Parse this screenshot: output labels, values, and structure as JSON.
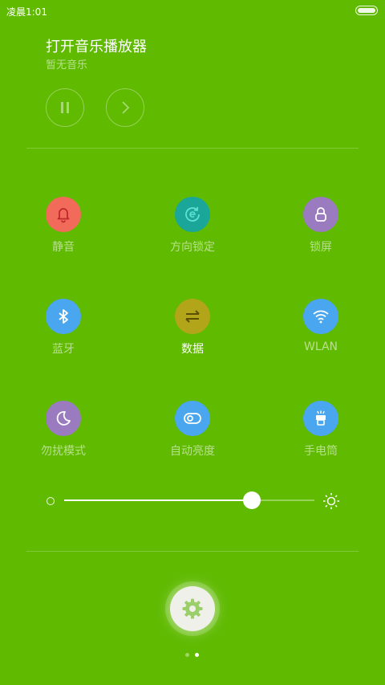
{
  "status_bar": {
    "time": "凌晨1:01"
  },
  "music": {
    "title": "打开音乐播放器",
    "subtitle": "暂无音乐"
  },
  "toggles": [
    {
      "label": "静音",
      "icon": "bell-icon",
      "color": "#f26b5a",
      "active": false
    },
    {
      "label": "方向锁定",
      "icon": "rotation-lock-icon",
      "color": "#1aa79a",
      "active": false
    },
    {
      "label": "锁屏",
      "icon": "lock-icon",
      "color": "#9a7bbf",
      "active": false
    },
    {
      "label": "蓝牙",
      "icon": "bluetooth-icon",
      "color": "#4aa6ee",
      "active": false
    },
    {
      "label": "数据",
      "icon": "data-transfer-icon",
      "color": "#b3a51a",
      "active": true
    },
    {
      "label": "WLAN",
      "icon": "wifi-icon",
      "color": "#4aa6ee",
      "active": false
    },
    {
      "label": "勿扰模式",
      "icon": "moon-icon",
      "color": "#9a7bbf",
      "active": false
    },
    {
      "label": "自动亮度",
      "icon": "toggle-icon",
      "color": "#4aa6ee",
      "active": false
    },
    {
      "label": "手电筒",
      "icon": "flashlight-icon",
      "color": "#4aa6ee",
      "active": false
    }
  ],
  "brightness": {
    "level_percent": 75
  },
  "pager": {
    "total_pages": 2,
    "current_page": 2
  },
  "settings": {
    "icon": "gear-icon"
  }
}
